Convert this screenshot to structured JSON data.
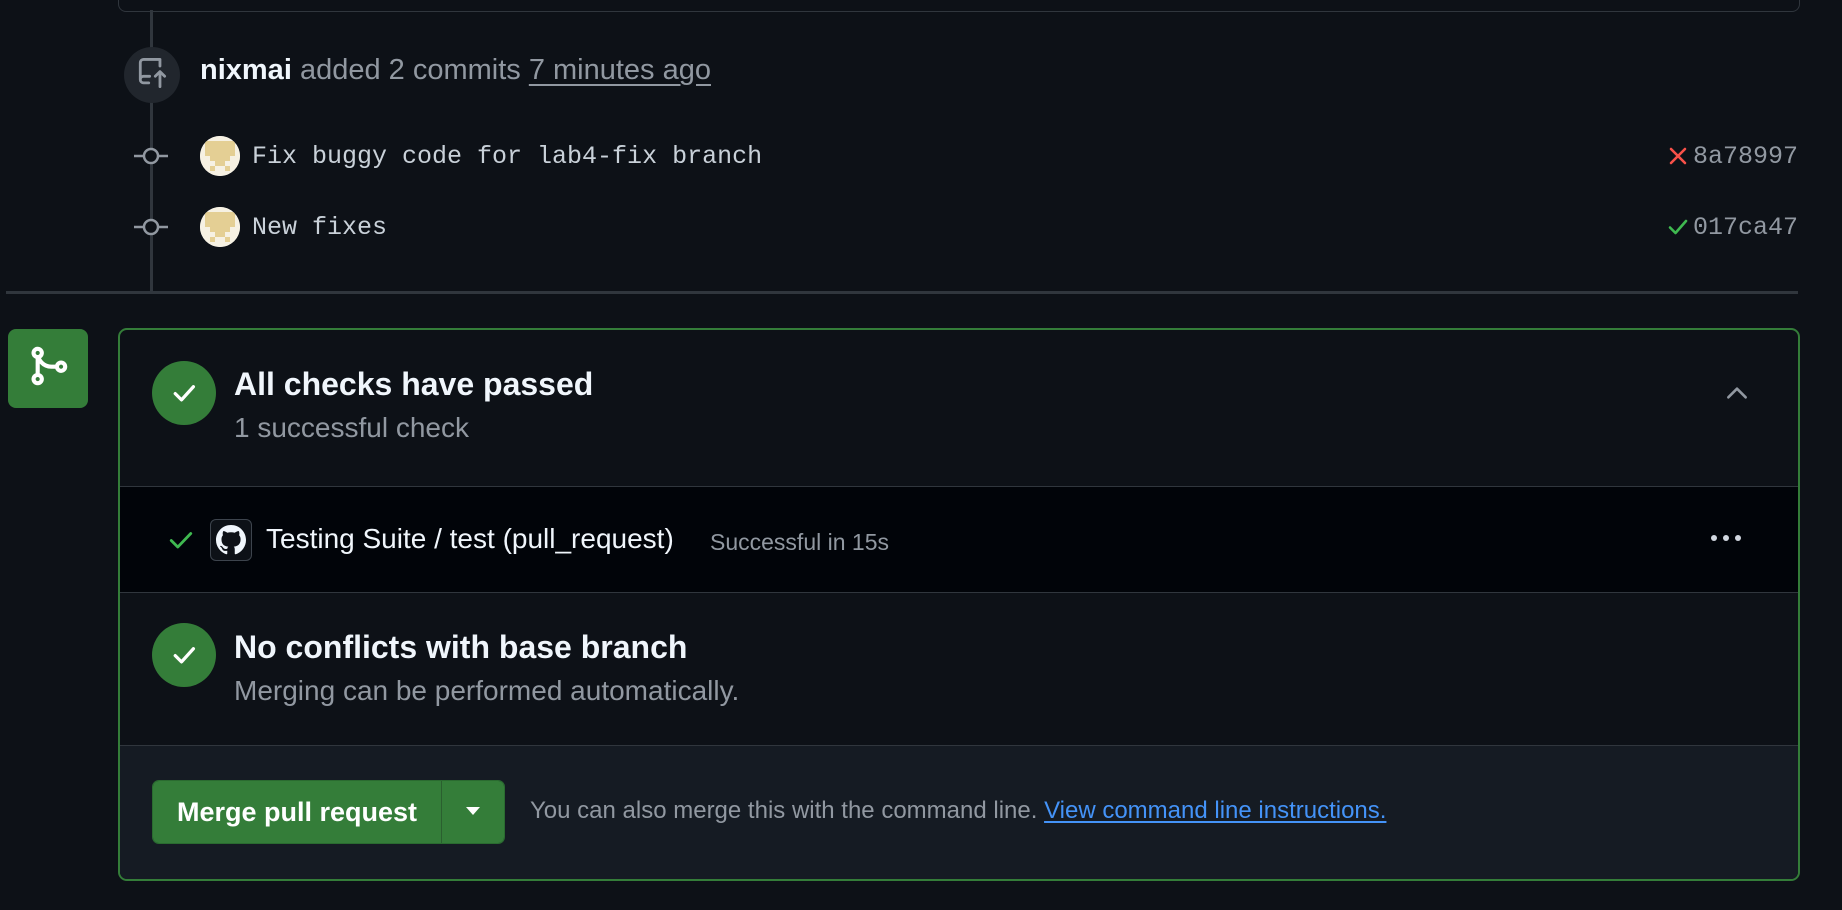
{
  "timeline": {
    "push_event": {
      "icon": "repo-push-icon",
      "author": "nixmai",
      "action": "added 2 commits",
      "time": "7 minutes ago"
    },
    "commits": [
      {
        "message": "Fix buggy code for lab4-fix branch",
        "status": "failure",
        "status_icon": "x-icon",
        "status_color": "#f85149",
        "sha": "8a78997"
      },
      {
        "message": "New fixes",
        "status": "success",
        "status_icon": "check-icon",
        "status_color": "#3fb950",
        "sha": "017ca47"
      }
    ]
  },
  "merge_box": {
    "badge_icon": "git-merge-icon",
    "checks": {
      "title": "All checks have passed",
      "subtitle": "1 successful check",
      "expanded": true
    },
    "check_run": {
      "name": "Testing Suite / test (pull_request)",
      "status": "Successful in 15s",
      "app_icon": "github-icon"
    },
    "conflicts": {
      "title": "No conflicts with base branch",
      "subtitle": "Merging can be performed automatically."
    },
    "merge": {
      "button_label": "Merge pull request",
      "hint": "You can also merge this with the command line.",
      "link_text": "View command line instructions."
    }
  },
  "colors": {
    "background": "#0d1117",
    "success": "#347d39",
    "border": "#30363d",
    "link": "#4493f8",
    "muted": "#9198a1"
  }
}
